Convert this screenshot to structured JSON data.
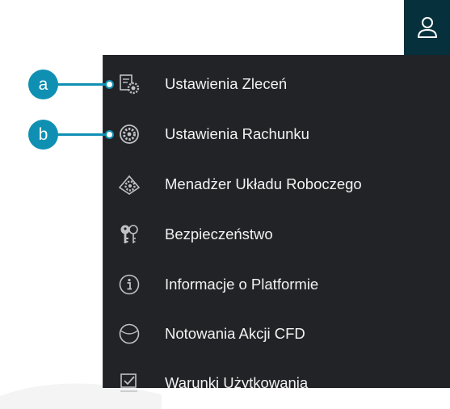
{
  "header": {
    "user_icon": "user-icon"
  },
  "menu": {
    "items": [
      {
        "label": "Ustawienia Zleceń",
        "icon": "order-settings-icon"
      },
      {
        "label": "Ustawienia Rachunku",
        "icon": "account-settings-icon"
      },
      {
        "label": "Menadżer Układu Roboczego",
        "icon": "workspace-manager-icon"
      },
      {
        "label": "Bezpieczeństwo",
        "icon": "keys-icon"
      },
      {
        "label": "Informacje o Platformie",
        "icon": "info-icon"
      },
      {
        "label": "Notowania Akcji CFD",
        "icon": "globe-icon"
      },
      {
        "label": "Warunki Użytkowania",
        "icon": "checkbox-icon"
      }
    ]
  },
  "callouts": [
    {
      "label": "a",
      "target": "Ustawienia Zleceń"
    },
    {
      "label": "b",
      "target": "Ustawienia Rachunku"
    }
  ],
  "colors": {
    "callout": "#0f90b3",
    "menu_bg": "#222327",
    "topbar_bg": "#06303c",
    "text": "#f2f2f2",
    "icon": "#bfc1c5"
  }
}
